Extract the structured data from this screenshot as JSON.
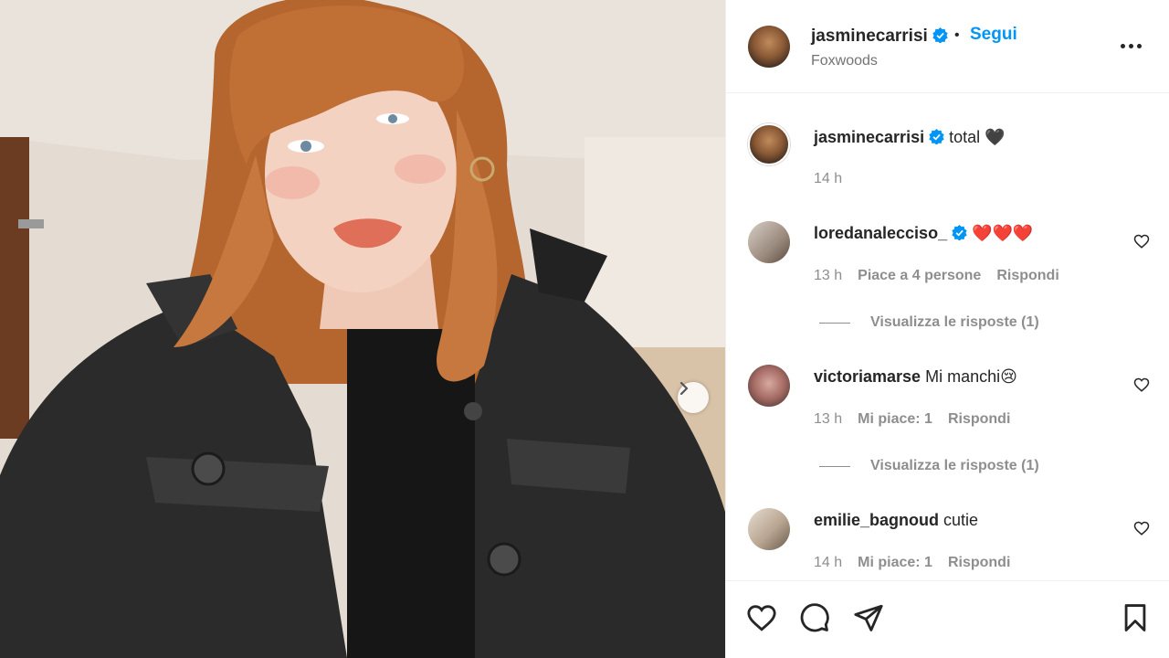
{
  "post": {
    "author": "jasminecarrisi",
    "follow_label": "Segui",
    "separator": "•",
    "location": "Foxwoods",
    "caption_user": "jasminecarrisi",
    "caption_text": "total 🖤",
    "caption_time": "14 h"
  },
  "comments": [
    {
      "user": "loredanalecciso_",
      "verified": true,
      "text": "❤️❤️❤️",
      "time": "13 h",
      "likes": "Piace a 4 persone",
      "reply": "Rispondi",
      "view_replies": "Visualizza le risposte (1)"
    },
    {
      "user": "victoriamarse",
      "verified": false,
      "text": "Mi manchi😢",
      "time": "13 h",
      "likes": "Mi piace: 1",
      "reply": "Rispondi",
      "view_replies": "Visualizza le risposte (1)"
    },
    {
      "user": "emilie_bagnoud",
      "verified": false,
      "text": "cutie",
      "time": "14 h",
      "likes": "Mi piace: 1",
      "reply": "Rispondi"
    }
  ],
  "icons": {
    "verified": "verified-badge-icon",
    "more": "more-options-icon",
    "like": "heart-icon",
    "comment": "comment-bubble-icon",
    "share": "paper-plane-icon",
    "save": "bookmark-icon",
    "next": "chevron-right-icon"
  },
  "colors": {
    "accent": "#0095f6",
    "text": "#262626",
    "muted": "#8e8e8e"
  }
}
